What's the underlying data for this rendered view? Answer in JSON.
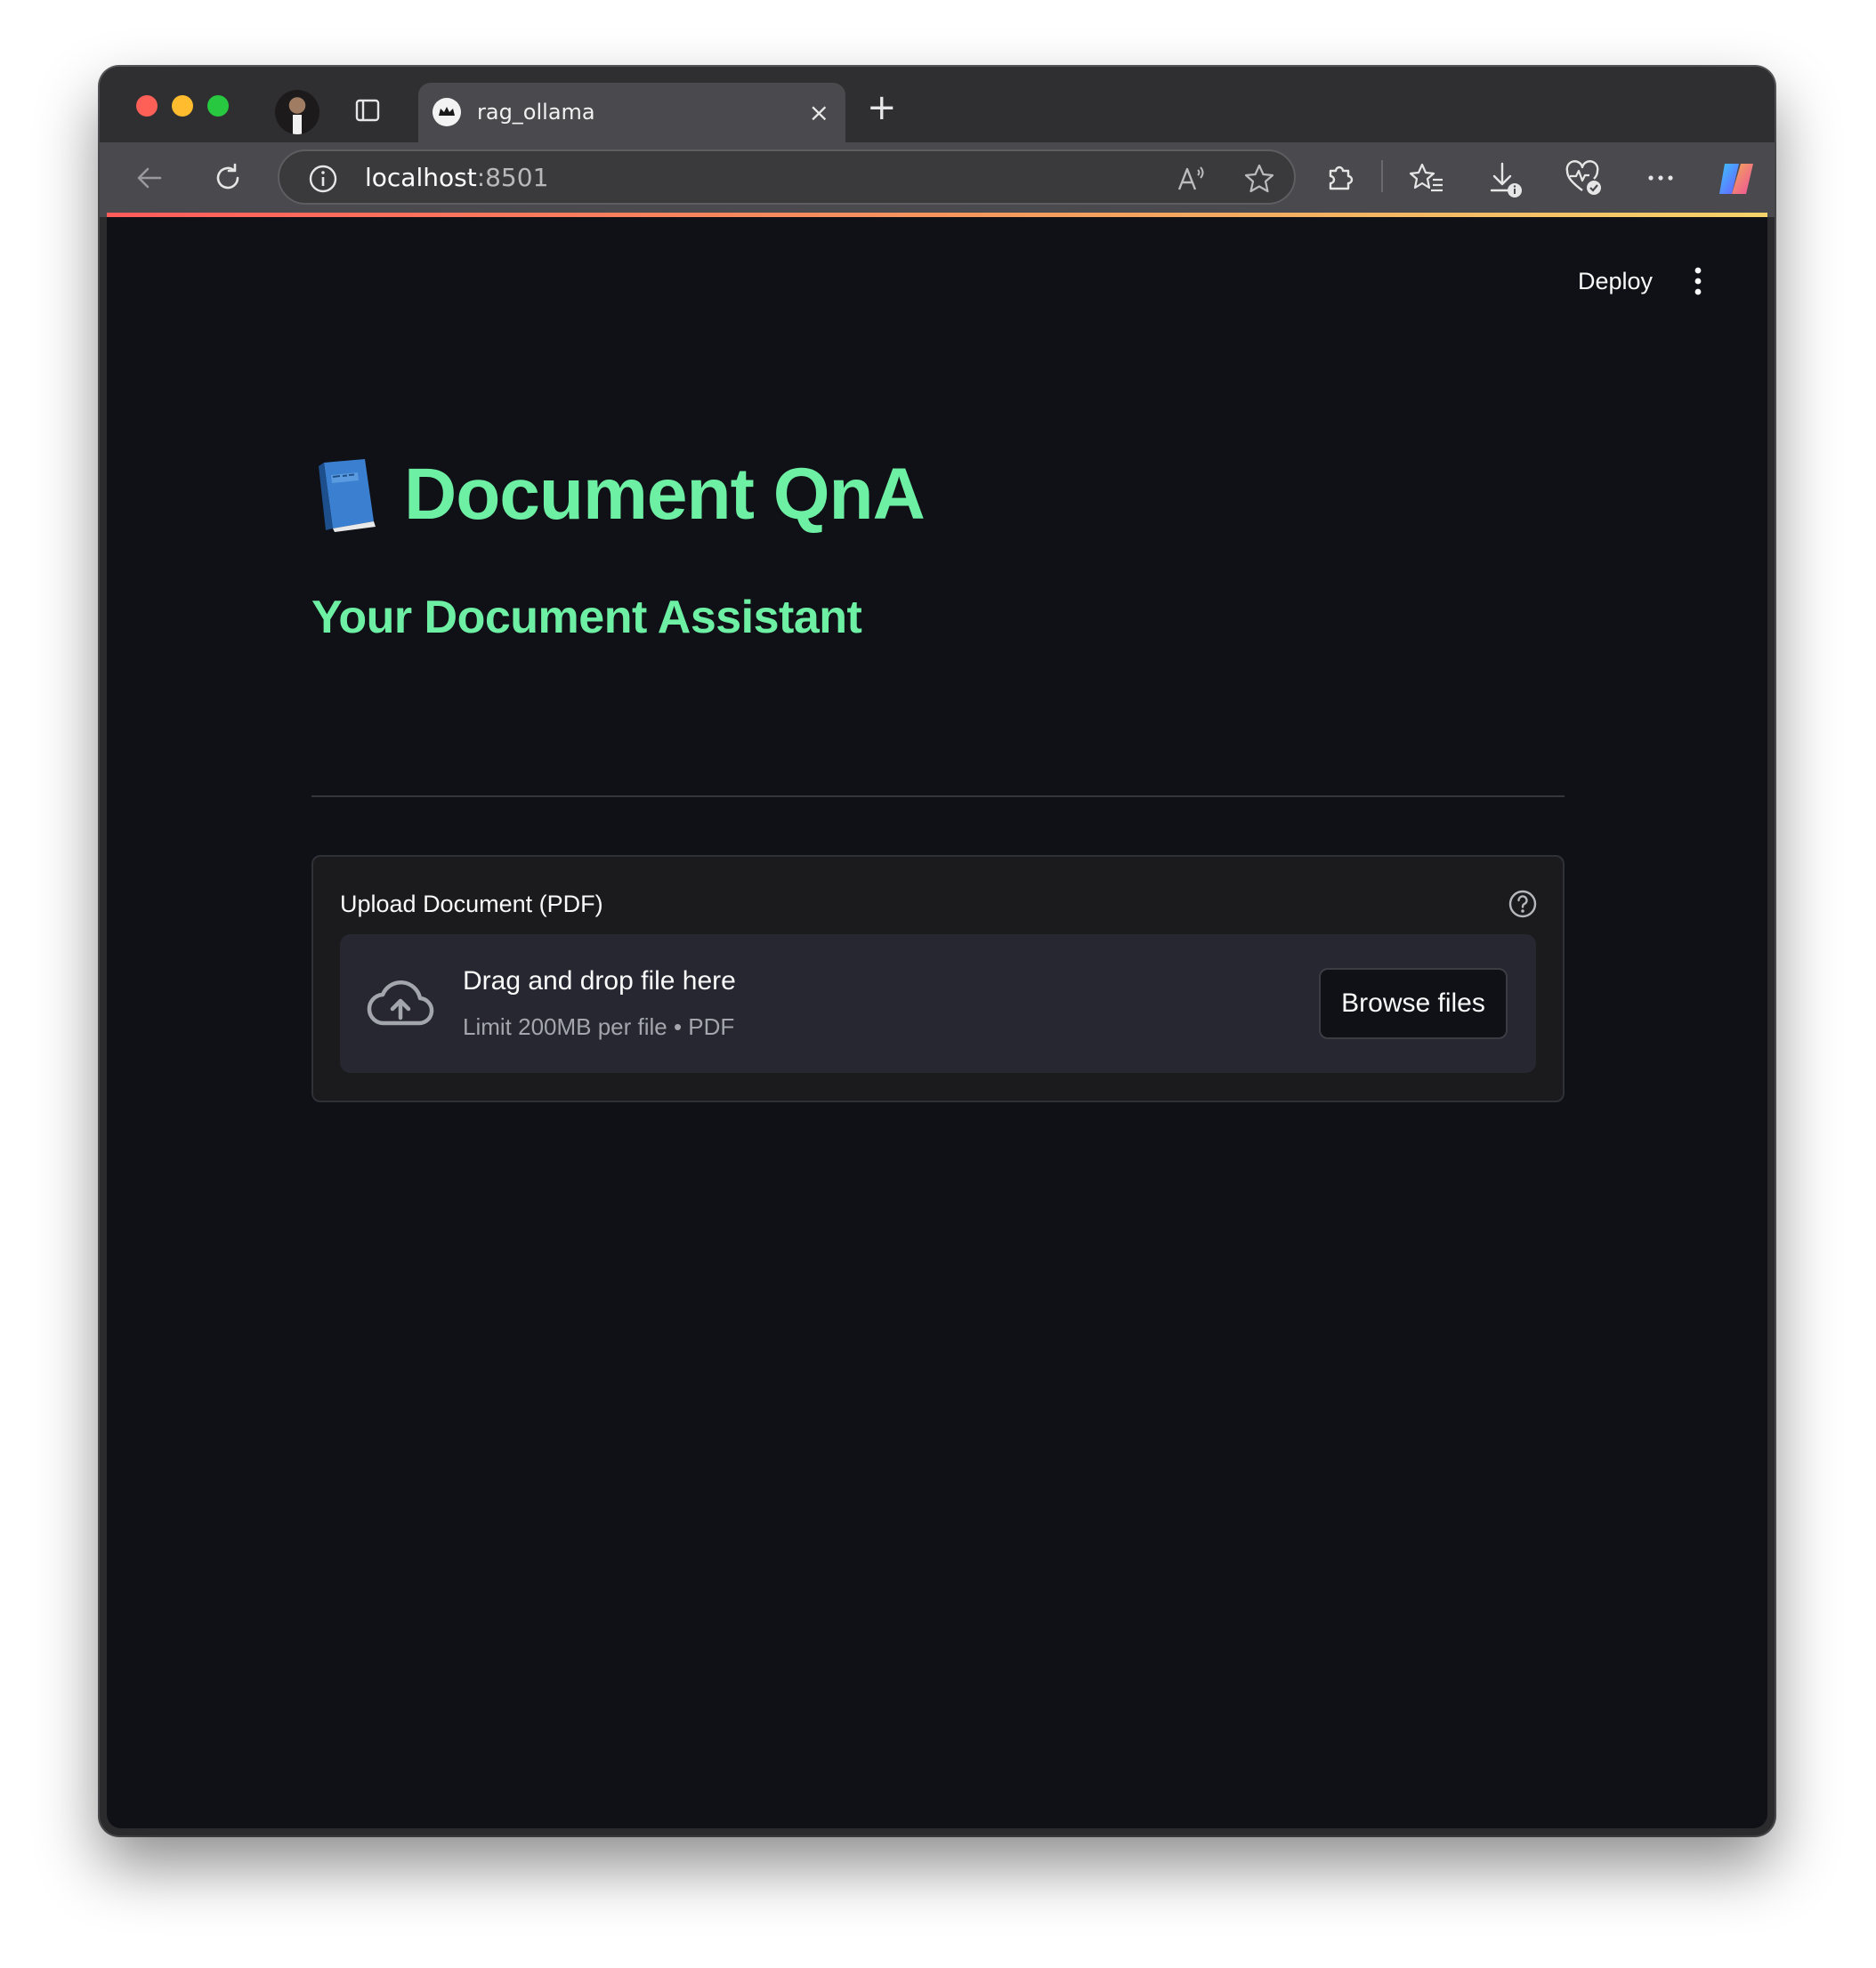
{
  "browser": {
    "tab_title": "rag_ollama",
    "tab_close": "×",
    "new_tab": "+",
    "url_host": "localhost",
    "url_port": ":8501"
  },
  "app": {
    "deploy_label": "Deploy",
    "title": "Document QnA",
    "subtitle": "Your Document Assistant",
    "uploader": {
      "label": "Upload Document (PDF)",
      "dropzone_title": "Drag and drop file here",
      "dropzone_limit": "Limit 200MB per file • PDF",
      "browse_label": "Browse files"
    }
  },
  "colors": {
    "accent_green": "#6df0a4",
    "page_background": "#0f1117",
    "dropzone_background": "#262730"
  },
  "icons": [
    "tabs-icon",
    "back-icon",
    "reload-icon",
    "info-icon",
    "read-aloud-icon",
    "favorite-star-icon",
    "extensions-icon",
    "favorites-icon",
    "downloads-icon",
    "browser-health-icon",
    "more-icon",
    "copilot-icon",
    "kebab-menu-icon",
    "book-icon",
    "help-icon",
    "cloud-upload-icon"
  ]
}
